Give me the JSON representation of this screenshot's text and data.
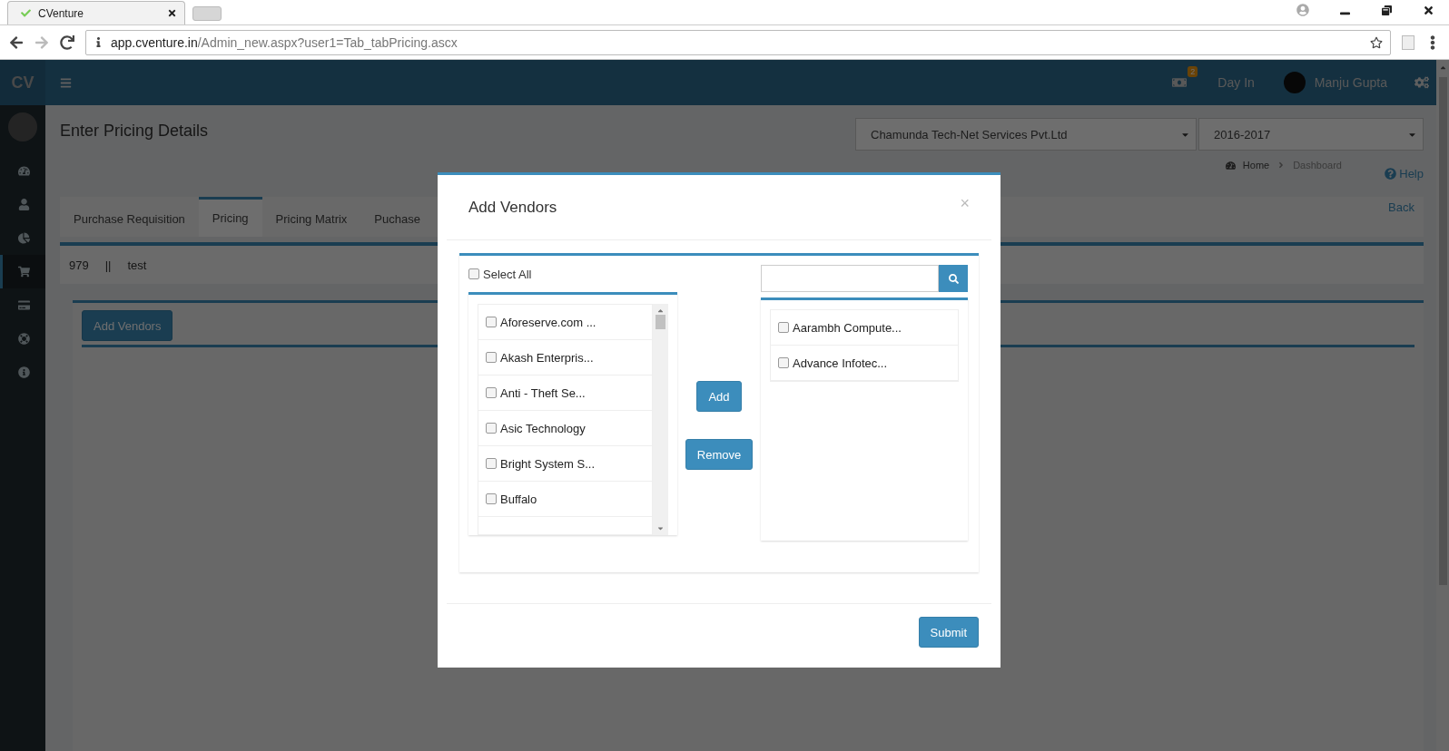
{
  "browser": {
    "tab_title": "CVenture",
    "url_host": "app.cventure.in",
    "url_path": "/Admin_new.aspx?user1=Tab_tabPricing.ascx"
  },
  "header": {
    "logo": "CV",
    "notification_count": "2",
    "day_in": "Day In",
    "user": "Manju Gupta"
  },
  "sidebar": {
    "items": [
      {
        "kind": "dashboard",
        "selected": false
      },
      {
        "kind": "user",
        "selected": false
      },
      {
        "kind": "chart",
        "selected": false
      },
      {
        "kind": "cart",
        "selected": true
      },
      {
        "kind": "card",
        "selected": false
      },
      {
        "kind": "support",
        "selected": false
      },
      {
        "kind": "info",
        "selected": false
      }
    ]
  },
  "page": {
    "title": "Enter Pricing Details",
    "company": "Chamunda Tech-Net Services Pvt.Ltd",
    "year": "2016-2017",
    "breadcrumb": [
      "Home",
      "Dashboard"
    ],
    "help": "Help",
    "back": "Back",
    "tabs": [
      {
        "label": "Purchase Requisition",
        "selected": false
      },
      {
        "label": "Pricing",
        "selected": true
      },
      {
        "label": "Pricing Matrix",
        "selected": false
      },
      {
        "label": "Puchase",
        "selected": false
      }
    ],
    "info": [
      "979",
      "||",
      "test"
    ],
    "add_vendors": "Add Vendors"
  },
  "modal": {
    "title": "Add Vendors",
    "close": "×",
    "select_all": {
      "label": "Select All",
      "checked": false
    },
    "available": [
      {
        "label": "Aforeserve.com ...",
        "checked": false
      },
      {
        "label": "Akash Enterpris...",
        "checked": false
      },
      {
        "label": "Anti - Theft Se...",
        "checked": false
      },
      {
        "label": "Asic Technology",
        "checked": false
      },
      {
        "label": "Bright System S...",
        "checked": false
      },
      {
        "label": "Buffalo",
        "checked": false
      }
    ],
    "selected_vendors": [
      {
        "label": "Aarambh Compute...",
        "checked": false
      },
      {
        "label": "Advance Infotec...",
        "checked": false
      }
    ],
    "add": "Add",
    "remove": "Remove",
    "submit": "Submit"
  }
}
